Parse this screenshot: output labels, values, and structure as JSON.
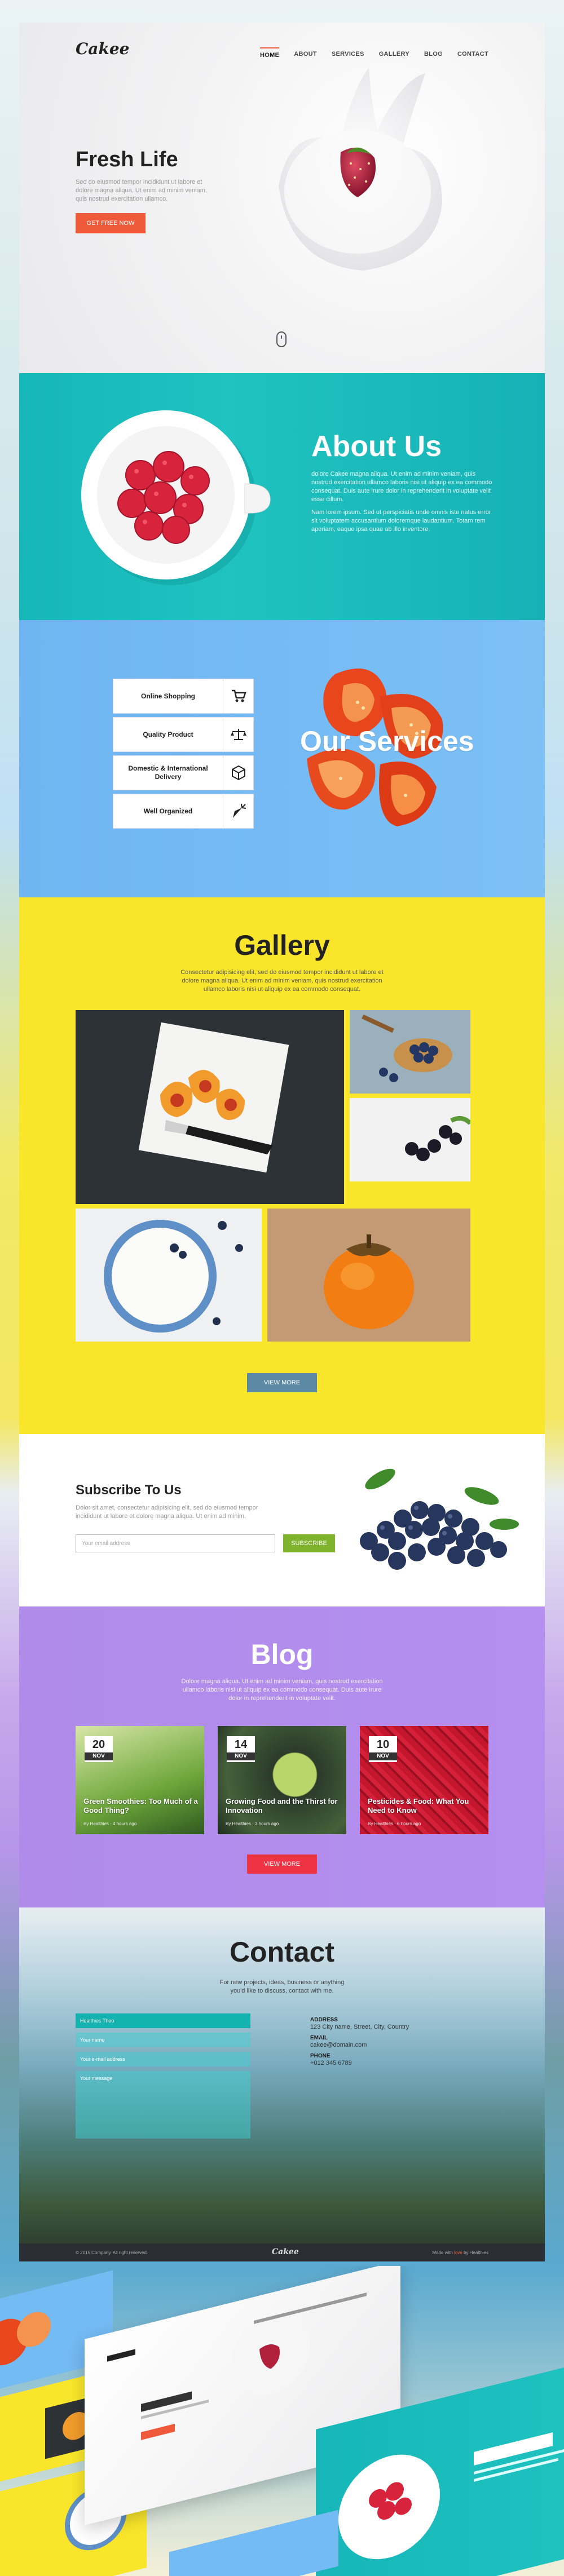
{
  "brand": {
    "logo": "Cakee"
  },
  "nav": {
    "items": [
      "HOME",
      "ABOUT",
      "SERVICES",
      "GALLERY",
      "BLOG",
      "CONTACT"
    ]
  },
  "hero": {
    "title": "Fresh Life",
    "text": "Sed do eiusmod tempor incididunt ut labore et dolore magna aliqua. Ut enim ad minim veniam, quis nostrud exercitation ullamco.",
    "button": "GET FREE NOW"
  },
  "about": {
    "title": "About Us",
    "p1": "dolore Cakee magna aliqua. Ut enim ad minim veniam, quis nostrud exercitation ullamco laboris nisi ut aliquip ex ea commodo consequat. Duis aute irure dolor in reprehenderit in voluptate velit esse cillum.",
    "p2": "Nam lorem ipsum. Sed ut perspiciatis unde omnis iste natus error sit voluptatem accusantium doloremque laudantium. Totam rem aperiam, eaque ipsa quae ab illo inventore."
  },
  "services": {
    "title": "Our Services",
    "items": [
      {
        "label": "Online Shopping",
        "icon": "cart-icon"
      },
      {
        "label": "Quality Product",
        "icon": "scale-icon"
      },
      {
        "label": "Domestic & International Delivery",
        "icon": "box-icon"
      },
      {
        "label": "Well Organized",
        "icon": "carrot-icon"
      }
    ]
  },
  "gallery": {
    "title": "Gallery",
    "text": "Consectetur adipisicing elit, sed do eiusmod tempor incididunt ut labore et dolore magna aliqua. Ut enim ad minim veniam, quis nostrud exercitation ullamco laboris nisi ut aliquip ex ea commodo consequat.",
    "button": "VIEW MORE"
  },
  "subscribe": {
    "title": "Subscribe To Us",
    "text": "Dolor sit amet, consectetur adipisicing elit, sed do eiusmod tempor incididunt ut labore et dolore magna aliqua. Ut enim ad minim.",
    "placeholder": "Your email address",
    "button": "SUBSCRIBE"
  },
  "blog": {
    "title": "Blog",
    "text": "Dolore magna aliqua. Ut enim ad minim veniam, quis nostrud exercitation ullamco laboris nisi ut aliquip ex ea commodo consequat. Duis aute irure dolor in reprehenderit in voluptate velit.",
    "button": "VIEW MORE",
    "posts": [
      {
        "day": "20",
        "month": "NOV",
        "title": "Green Smoothies: Too Much of a Good Thing?",
        "meta": "By Healthies · 4 hours ago"
      },
      {
        "day": "14",
        "month": "NOV",
        "title": "Growing Food and the Thirst for Innovation",
        "meta": "By Healthies · 3 hours ago"
      },
      {
        "day": "10",
        "month": "NOV",
        "title": "Pesticides & Food: What You Need to Know",
        "meta": "By Healthies · 6 hours ago"
      }
    ]
  },
  "contact": {
    "title": "Contact",
    "text": "For new projects, ideas, business or anything you'd like to discuss, contact with me.",
    "fields": [
      "Healthies Theo",
      "Your name",
      "Your e-mail address",
      "Your message"
    ],
    "address_label": "ADDRESS",
    "address": "123 City name, Street, City, Country",
    "email_label": "EMAIL",
    "email": "cakee@domain.com",
    "phone_label": "PHONE",
    "phone": "+012 345 6789"
  },
  "footer": {
    "copyright": "© 2015 Company. All right reserved.",
    "logo": "Cakee",
    "made_prefix": "Made with",
    "made_link": "love",
    "made_suffix": "by Healthies"
  },
  "colors": {
    "accent": "#ef5b3a",
    "teal": "#16b6b9",
    "blue": "#74baf3",
    "yellow": "#f9e62b",
    "purple": "#b08be9",
    "green": "#7fb32d",
    "red": "#ee3345"
  }
}
